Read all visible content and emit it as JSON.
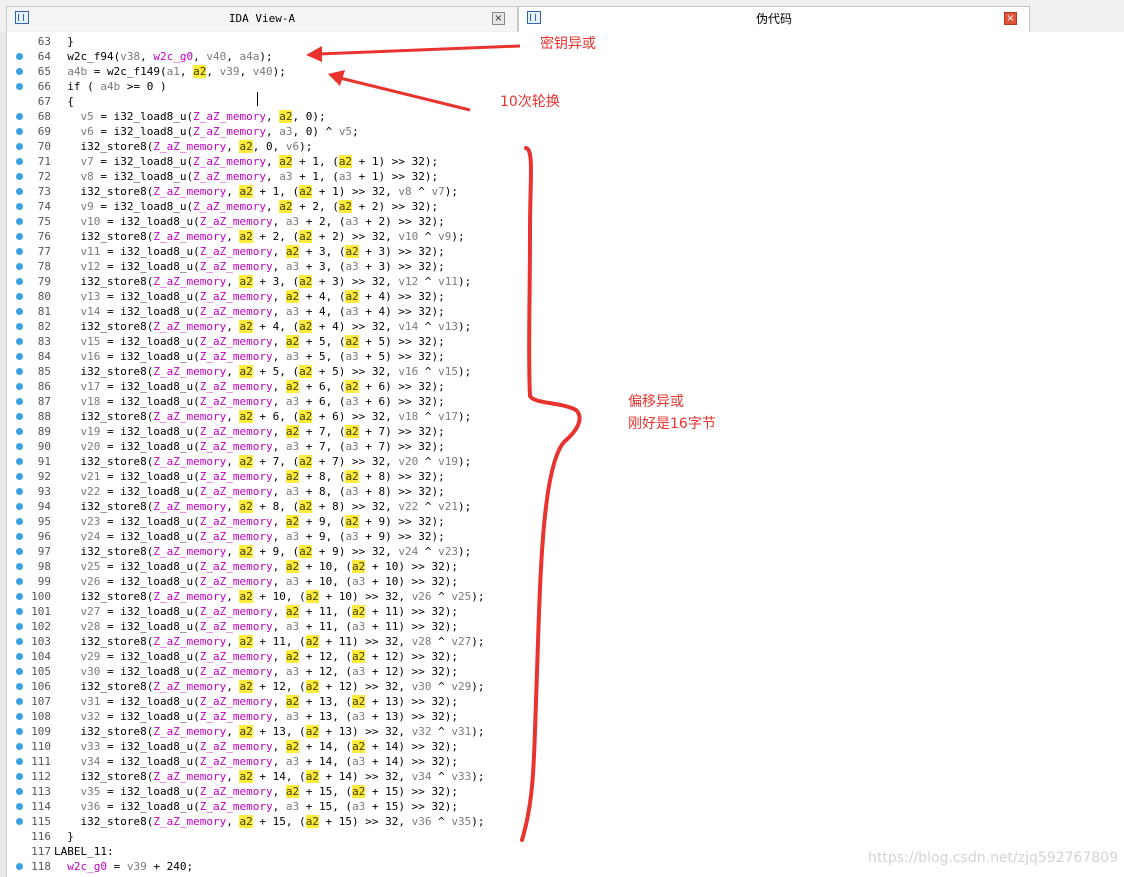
{
  "tabs": [
    {
      "title": "IDA View-A",
      "close_glyph": "×",
      "active": false
    },
    {
      "title": "伪代码",
      "close_glyph": "×",
      "active": true
    }
  ],
  "colors": {
    "accent_blue": "#2d64b3",
    "breakpoint": "#3aa0e0",
    "annotation": "#e8332f",
    "highlight": "#ffeb3b"
  },
  "icons": {
    "tab": "pseudocode-view-icon",
    "close": "close-icon",
    "breakpoint": "breakpoint-dot-icon"
  },
  "lines": [
    {
      "no": "63",
      "bp": false,
      "text": "  }"
    },
    {
      "no": "64",
      "bp": true,
      "text": "  w2c_f94(v38, w2c_g0, v40, a4a);"
    },
    {
      "no": "65",
      "bp": true,
      "text": "  a4b = w2c_f149(a1, a2, v39, v40);"
    },
    {
      "no": "66",
      "bp": true,
      "text": "  if ( a4b >= 0 )"
    },
    {
      "no": "67",
      "bp": false,
      "text": "  {"
    },
    {
      "no": "68",
      "bp": true,
      "text": "    v5 = i32_load8_u(Z_aZ_memory, a2, 0);"
    },
    {
      "no": "69",
      "bp": true,
      "text": "    v6 = i32_load8_u(Z_aZ_memory, a3, 0) ^ v5;"
    },
    {
      "no": "70",
      "bp": true,
      "text": "    i32_store8(Z_aZ_memory, a2, 0, v6);"
    },
    {
      "no": "71",
      "bp": true,
      "text": "    v7 = i32_load8_u(Z_aZ_memory, a2 + 1, (a2 + 1) >> 32);"
    },
    {
      "no": "72",
      "bp": true,
      "text": "    v8 = i32_load8_u(Z_aZ_memory, a3 + 1, (a3 + 1) >> 32);"
    },
    {
      "no": "73",
      "bp": true,
      "text": "    i32_store8(Z_aZ_memory, a2 + 1, (a2 + 1) >> 32, v8 ^ v7);"
    },
    {
      "no": "74",
      "bp": true,
      "text": "    v9 = i32_load8_u(Z_aZ_memory, a2 + 2, (a2 + 2) >> 32);"
    },
    {
      "no": "75",
      "bp": true,
      "text": "    v10 = i32_load8_u(Z_aZ_memory, a3 + 2, (a3 + 2) >> 32);"
    },
    {
      "no": "76",
      "bp": true,
      "text": "    i32_store8(Z_aZ_memory, a2 + 2, (a2 + 2) >> 32, v10 ^ v9);"
    },
    {
      "no": "77",
      "bp": true,
      "text": "    v11 = i32_load8_u(Z_aZ_memory, a2 + 3, (a2 + 3) >> 32);"
    },
    {
      "no": "78",
      "bp": true,
      "text": "    v12 = i32_load8_u(Z_aZ_memory, a3 + 3, (a3 + 3) >> 32);"
    },
    {
      "no": "79",
      "bp": true,
      "text": "    i32_store8(Z_aZ_memory, a2 + 3, (a2 + 3) >> 32, v12 ^ v11);"
    },
    {
      "no": "80",
      "bp": true,
      "text": "    v13 = i32_load8_u(Z_aZ_memory, a2 + 4, (a2 + 4) >> 32);"
    },
    {
      "no": "81",
      "bp": true,
      "text": "    v14 = i32_load8_u(Z_aZ_memory, a3 + 4, (a3 + 4) >> 32);"
    },
    {
      "no": "82",
      "bp": true,
      "text": "    i32_store8(Z_aZ_memory, a2 + 4, (a2 + 4) >> 32, v14 ^ v13);"
    },
    {
      "no": "83",
      "bp": true,
      "text": "    v15 = i32_load8_u(Z_aZ_memory, a2 + 5, (a2 + 5) >> 32);"
    },
    {
      "no": "84",
      "bp": true,
      "text": "    v16 = i32_load8_u(Z_aZ_memory, a3 + 5, (a3 + 5) >> 32);"
    },
    {
      "no": "85",
      "bp": true,
      "text": "    i32_store8(Z_aZ_memory, a2 + 5, (a2 + 5) >> 32, v16 ^ v15);"
    },
    {
      "no": "86",
      "bp": true,
      "text": "    v17 = i32_load8_u(Z_aZ_memory, a2 + 6, (a2 + 6) >> 32);"
    },
    {
      "no": "87",
      "bp": true,
      "text": "    v18 = i32_load8_u(Z_aZ_memory, a3 + 6, (a3 + 6) >> 32);"
    },
    {
      "no": "88",
      "bp": true,
      "text": "    i32_store8(Z_aZ_memory, a2 + 6, (a2 + 6) >> 32, v18 ^ v17);"
    },
    {
      "no": "89",
      "bp": true,
      "text": "    v19 = i32_load8_u(Z_aZ_memory, a2 + 7, (a2 + 7) >> 32);"
    },
    {
      "no": "90",
      "bp": true,
      "text": "    v20 = i32_load8_u(Z_aZ_memory, a3 + 7, (a3 + 7) >> 32);"
    },
    {
      "no": "91",
      "bp": true,
      "text": "    i32_store8(Z_aZ_memory, a2 + 7, (a2 + 7) >> 32, v20 ^ v19);"
    },
    {
      "no": "92",
      "bp": true,
      "text": "    v21 = i32_load8_u(Z_aZ_memory, a2 + 8, (a2 + 8) >> 32);"
    },
    {
      "no": "93",
      "bp": true,
      "text": "    v22 = i32_load8_u(Z_aZ_memory, a3 + 8, (a3 + 8) >> 32);"
    },
    {
      "no": "94",
      "bp": true,
      "text": "    i32_store8(Z_aZ_memory, a2 + 8, (a2 + 8) >> 32, v22 ^ v21);"
    },
    {
      "no": "95",
      "bp": true,
      "text": "    v23 = i32_load8_u(Z_aZ_memory, a2 + 9, (a2 + 9) >> 32);"
    },
    {
      "no": "96",
      "bp": true,
      "text": "    v24 = i32_load8_u(Z_aZ_memory, a3 + 9, (a3 + 9) >> 32);"
    },
    {
      "no": "97",
      "bp": true,
      "text": "    i32_store8(Z_aZ_memory, a2 + 9, (a2 + 9) >> 32, v24 ^ v23);"
    },
    {
      "no": "98",
      "bp": true,
      "text": "    v25 = i32_load8_u(Z_aZ_memory, a2 + 10, (a2 + 10) >> 32);"
    },
    {
      "no": "99",
      "bp": true,
      "text": "    v26 = i32_load8_u(Z_aZ_memory, a3 + 10, (a3 + 10) >> 32);"
    },
    {
      "no": "100",
      "bp": true,
      "text": "    i32_store8(Z_aZ_memory, a2 + 10, (a2 + 10) >> 32, v26 ^ v25);"
    },
    {
      "no": "101",
      "bp": true,
      "text": "    v27 = i32_load8_u(Z_aZ_memory, a2 + 11, (a2 + 11) >> 32);"
    },
    {
      "no": "102",
      "bp": true,
      "text": "    v28 = i32_load8_u(Z_aZ_memory, a3 + 11, (a3 + 11) >> 32);"
    },
    {
      "no": "103",
      "bp": true,
      "text": "    i32_store8(Z_aZ_memory, a2 + 11, (a2 + 11) >> 32, v28 ^ v27);"
    },
    {
      "no": "104",
      "bp": true,
      "text": "    v29 = i32_load8_u(Z_aZ_memory, a2 + 12, (a2 + 12) >> 32);"
    },
    {
      "no": "105",
      "bp": true,
      "text": "    v30 = i32_load8_u(Z_aZ_memory, a3 + 12, (a3 + 12) >> 32);"
    },
    {
      "no": "106",
      "bp": true,
      "text": "    i32_store8(Z_aZ_memory, a2 + 12, (a2 + 12) >> 32, v30 ^ v29);"
    },
    {
      "no": "107",
      "bp": true,
      "text": "    v31 = i32_load8_u(Z_aZ_memory, a2 + 13, (a2 + 13) >> 32);"
    },
    {
      "no": "108",
      "bp": true,
      "text": "    v32 = i32_load8_u(Z_aZ_memory, a3 + 13, (a3 + 13) >> 32);"
    },
    {
      "no": "109",
      "bp": true,
      "text": "    i32_store8(Z_aZ_memory, a2 + 13, (a2 + 13) >> 32, v32 ^ v31);"
    },
    {
      "no": "110",
      "bp": true,
      "text": "    v33 = i32_load8_u(Z_aZ_memory, a2 + 14, (a2 + 14) >> 32);"
    },
    {
      "no": "111",
      "bp": true,
      "text": "    v34 = i32_load8_u(Z_aZ_memory, a3 + 14, (a3 + 14) >> 32);"
    },
    {
      "no": "112",
      "bp": true,
      "text": "    i32_store8(Z_aZ_memory, a2 + 14, (a2 + 14) >> 32, v34 ^ v33);"
    },
    {
      "no": "113",
      "bp": true,
      "text": "    v35 = i32_load8_u(Z_aZ_memory, a2 + 15, (a2 + 15) >> 32);"
    },
    {
      "no": "114",
      "bp": true,
      "text": "    v36 = i32_load8_u(Z_aZ_memory, a3 + 15, (a3 + 15) >> 32);"
    },
    {
      "no": "115",
      "bp": true,
      "text": "    i32_store8(Z_aZ_memory, a2 + 15, (a2 + 15) >> 32, v36 ^ v35);"
    },
    {
      "no": "116",
      "bp": false,
      "text": "  }"
    },
    {
      "no": "117",
      "bp": false,
      "text": "LABEL_11:"
    },
    {
      "no": "118",
      "bp": true,
      "text": "  w2c_g0 = v39 + 240;"
    }
  ],
  "annotations": {
    "key_xor": "密钥异或",
    "rounds": "10次轮换",
    "offset_xor_1": "偏移异或",
    "offset_xor_2": "刚好是16字节"
  },
  "watermark": "https://blog.csdn.net/zjq592767809"
}
